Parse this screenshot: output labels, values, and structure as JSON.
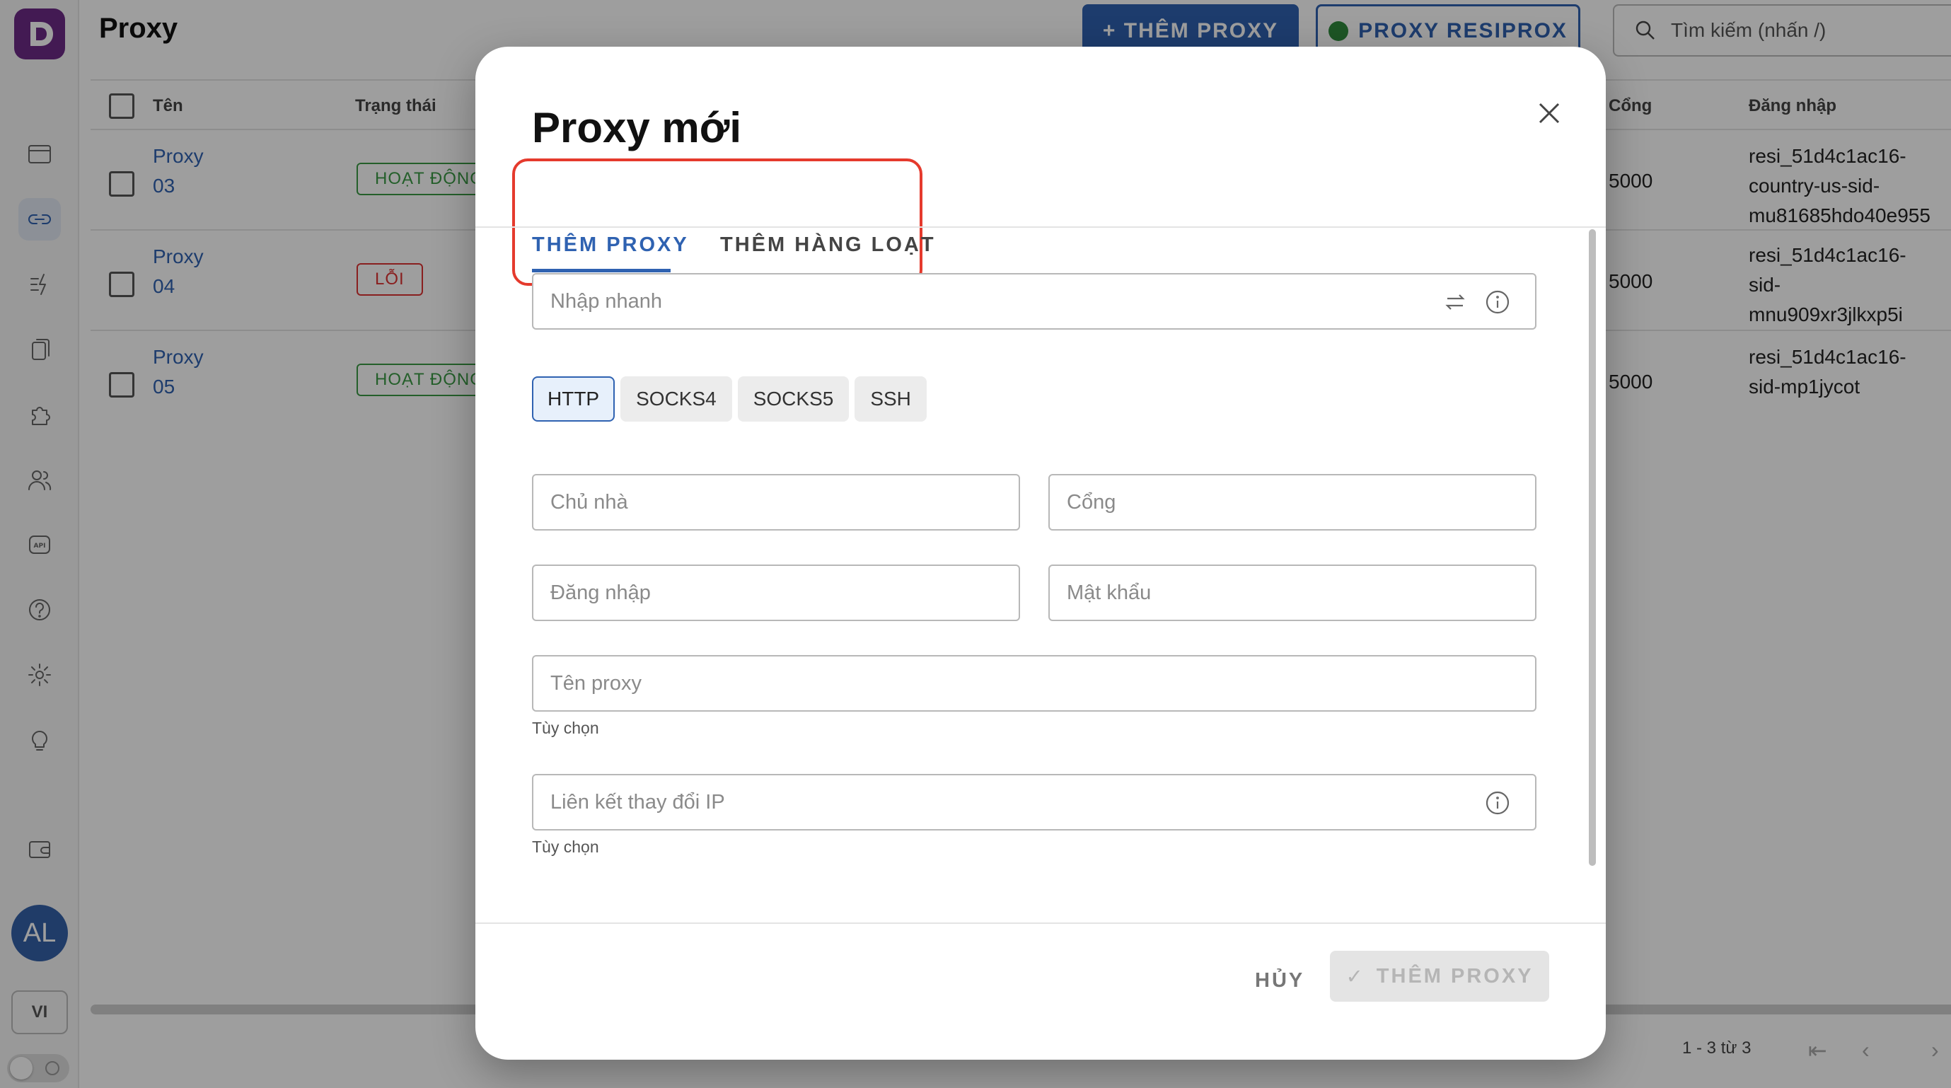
{
  "app": {
    "page_title": "Proxy",
    "add_proxy_button": "+ THÊM PROXY",
    "resiprox_button": "PROXY RESIPROX",
    "search_placeholder": "Tìm kiếm (nhấn /)",
    "avatar_initials": "AL",
    "language": "VI"
  },
  "table": {
    "columns": [
      "Tên",
      "Trạng thái",
      "Cổng",
      "Đăng nhập"
    ],
    "rows": [
      {
        "name_line1": "Proxy",
        "name_line2": "03",
        "status": "HOẠT ĐỘNG",
        "port": "5000",
        "login_lines": [
          "resi_51d4c1ac16-",
          "country-us-sid-",
          "mu81685hdo40e955"
        ]
      },
      {
        "name_line1": "Proxy",
        "name_line2": "04",
        "status": "LỖI",
        "port": "5000",
        "login_lines": [
          "resi_51d4c1ac16-",
          "sid-",
          "mnu909xr3jlkxp5i"
        ]
      },
      {
        "name_line1": "Proxy",
        "name_line2": "05",
        "status": "HOẠT ĐỘNG",
        "port": "5000",
        "login_lines": [
          "resi_51d4c1ac16-",
          "sid-mp1jycot"
        ]
      }
    ],
    "pagination": "1 - 3 từ 3"
  },
  "modal": {
    "title": "Proxy mới",
    "tabs": [
      {
        "label": "THÊM PROXY",
        "active": true
      },
      {
        "label": "THÊM HÀNG LOẠT",
        "active": false
      }
    ],
    "quick_input_placeholder": "Nhập nhanh",
    "protocols": [
      {
        "label": "HTTP",
        "active": true
      },
      {
        "label": "SOCKS4",
        "active": false
      },
      {
        "label": "SOCKS5",
        "active": false
      },
      {
        "label": "SSH",
        "active": false
      }
    ],
    "host_placeholder": "Chủ nhà",
    "port_placeholder": "Cổng",
    "login_placeholder": "Đăng nhập",
    "password_placeholder": "Mật khẩu",
    "name_placeholder": "Tên proxy",
    "name_helper": "Tùy chọn",
    "ip_change_placeholder": "Liên kết thay đổi IP",
    "ip_change_helper": "Tùy chọn",
    "cancel_label": "HỦY",
    "submit_label": "THÊM PROXY"
  },
  "colors": {
    "primary": "#2f62b1",
    "highlight": "#e53a2d",
    "status_ok": "#3a9a45",
    "status_error": "#dd3333"
  }
}
